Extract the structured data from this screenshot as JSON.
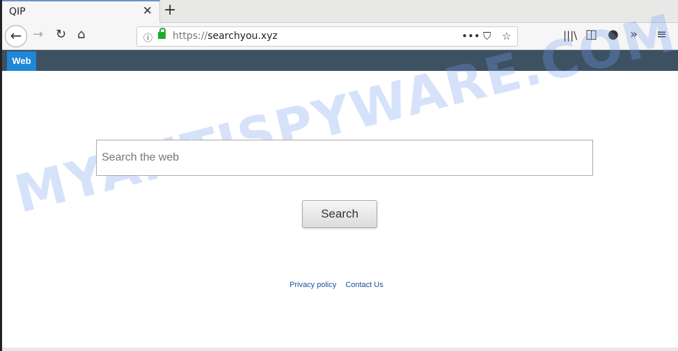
{
  "browser": {
    "tab_title": "QIP",
    "url_scheme": "https://",
    "url_host": "searchyou.xyz"
  },
  "site": {
    "nav_tab": "Web",
    "search_placeholder": "Search the web",
    "search_button": "Search",
    "links": [
      "Privacy policy",
      "Contact Us"
    ]
  },
  "watermark": "MYANTISPYWARE.COM",
  "colors": {
    "site_bar": "#3c5162",
    "web_tab": "#1f87d8",
    "link": "#1a4a9a"
  }
}
